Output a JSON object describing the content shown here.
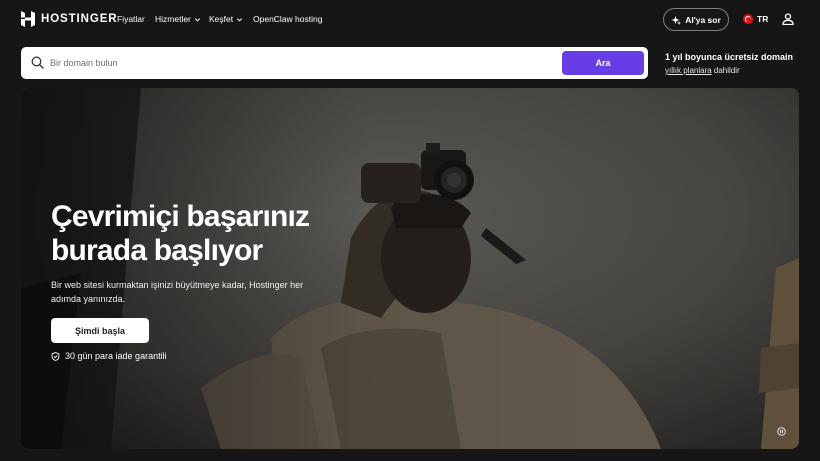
{
  "brand": {
    "name": "HOSTINGER"
  },
  "nav": {
    "links": [
      {
        "label": "Fiyatlar",
        "has_dropdown": false
      },
      {
        "label": "Hizmetler",
        "has_dropdown": true
      },
      {
        "label": "Keşfet",
        "has_dropdown": true
      },
      {
        "label": "OpenClaw hosting",
        "has_dropdown": false
      }
    ],
    "ai_button": "AI'ya sor",
    "language": "TR"
  },
  "search": {
    "placeholder": "Bir domain bulun",
    "value": "",
    "button": "Ara"
  },
  "promo": {
    "title": "1 yıl boyunca ücretsiz domain",
    "link": "yıllık planlara",
    "suffix": " dahildir"
  },
  "hero": {
    "title": "Çevrimiçi başarınız burada başlıyor",
    "subtitle": "Bir web sitesi kurmaktan işinizi büyütmeye kadar, Hostinger her adımda yanınızda.",
    "cta": "Şimdi başla",
    "guarantee": "30 gün para iade garantili"
  },
  "colors": {
    "background": "#161617",
    "accent": "#673de6",
    "white": "#ffffff"
  },
  "icons": [
    "hostinger-logo-icon",
    "chevron-down-icon",
    "sparkle-icon",
    "turkey-flag-icon",
    "user-icon",
    "search-icon",
    "shield-check-icon",
    "pause-icon"
  ]
}
